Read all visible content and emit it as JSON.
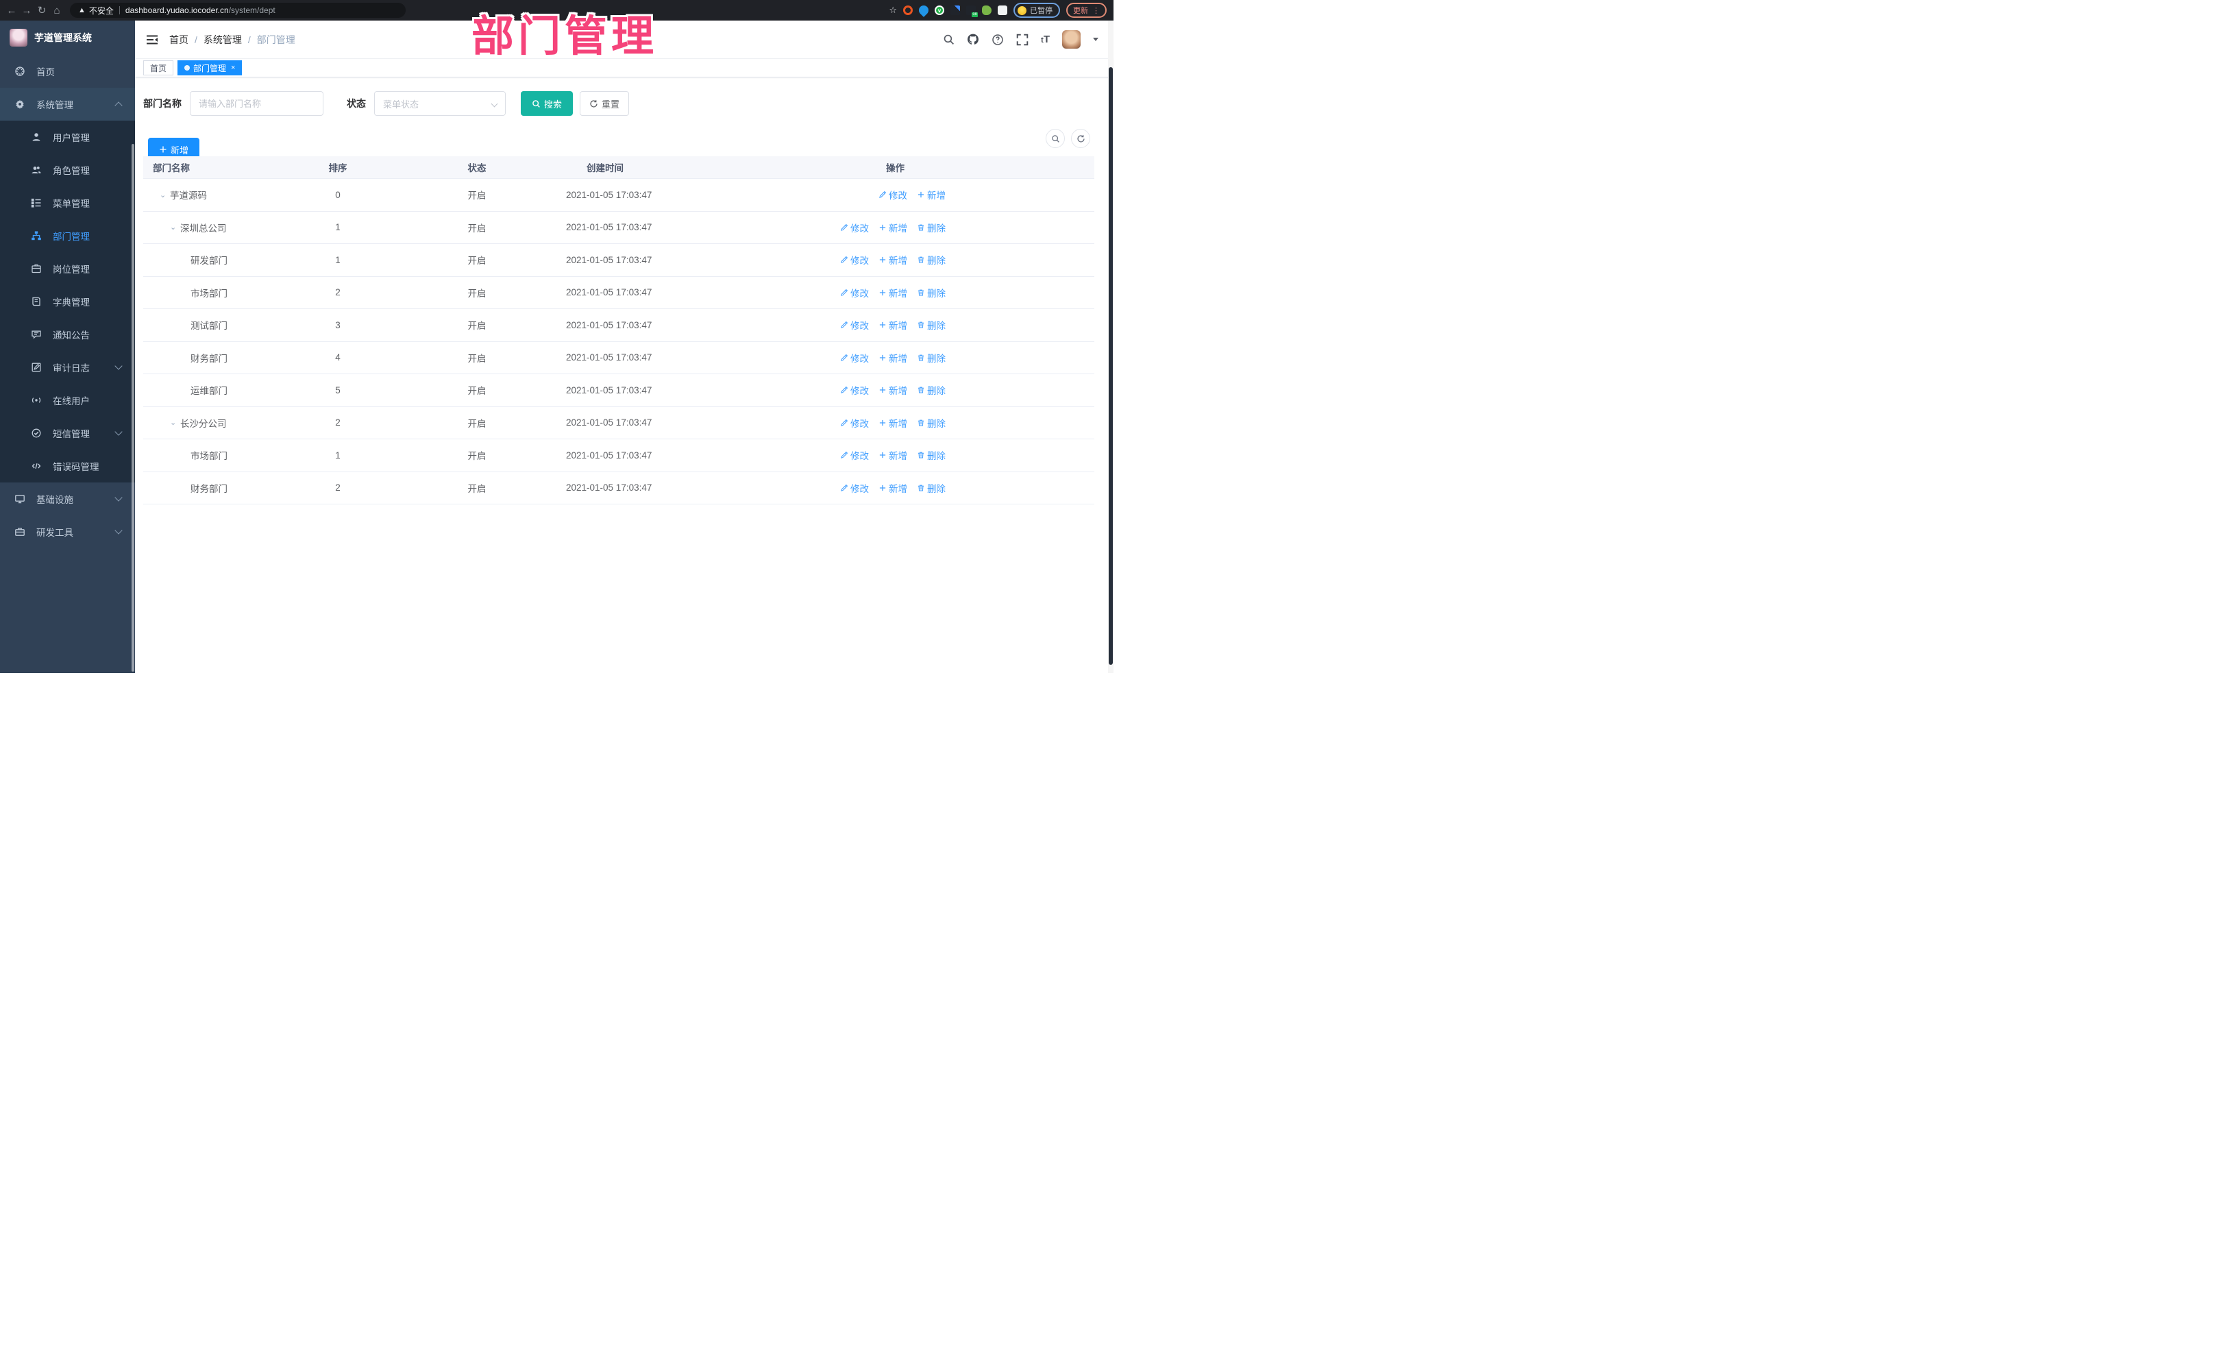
{
  "browser": {
    "security_label": "不安全",
    "url_host": "dashboard.yudao.iocoder.cn",
    "url_path": "/system/dept",
    "paused_label": "已暂停",
    "update_label": "更新"
  },
  "overlay": {
    "title": "部门管理"
  },
  "sidebar": {
    "app_title": "芋道管理系统",
    "items": [
      {
        "label": "首页",
        "icon": "dashboard-icon",
        "type": "top"
      },
      {
        "label": "系统管理",
        "icon": "gear-icon",
        "type": "top",
        "chevron": "up",
        "highlight": true
      },
      {
        "label": "用户管理",
        "icon": "user-icon",
        "type": "sub"
      },
      {
        "label": "角色管理",
        "icon": "users-icon",
        "type": "sub"
      },
      {
        "label": "菜单管理",
        "icon": "menu-tree-icon",
        "type": "sub"
      },
      {
        "label": "部门管理",
        "icon": "org-tree-icon",
        "type": "sub",
        "active": true
      },
      {
        "label": "岗位管理",
        "icon": "badge-icon",
        "type": "sub"
      },
      {
        "label": "字典管理",
        "icon": "book-icon",
        "type": "sub"
      },
      {
        "label": "通知公告",
        "icon": "announcement-icon",
        "type": "sub"
      },
      {
        "label": "审计日志",
        "icon": "audit-log-icon",
        "type": "sub",
        "chevron": "down"
      },
      {
        "label": "在线用户",
        "icon": "online-user-icon",
        "type": "sub"
      },
      {
        "label": "短信管理",
        "icon": "sms-icon",
        "type": "sub",
        "chevron": "down"
      },
      {
        "label": "错误码管理",
        "icon": "error-code-icon",
        "type": "sub"
      },
      {
        "label": "基础设施",
        "icon": "infra-icon",
        "type": "top",
        "chevron": "down"
      },
      {
        "label": "研发工具",
        "icon": "devtools-icon",
        "type": "top",
        "chevron": "down"
      }
    ]
  },
  "header": {
    "breadcrumb": [
      "首页",
      "系统管理",
      "部门管理"
    ]
  },
  "tags": [
    {
      "label": "首页",
      "active": false
    },
    {
      "label": "部门管理",
      "active": true
    }
  ],
  "filters": {
    "dept_name_label": "部门名称",
    "dept_name_placeholder": "请输入部门名称",
    "dept_name_value": "",
    "status_label": "状态",
    "status_placeholder": "菜单状态",
    "search_label": "搜索",
    "reset_label": "重置"
  },
  "toolbar": {
    "add_label": "新增"
  },
  "table": {
    "columns": [
      "部门名称",
      "排序",
      "状态",
      "创建时间",
      "操作"
    ],
    "action_labels": {
      "edit": "修改",
      "add": "新增",
      "delete": "删除"
    },
    "rows": [
      {
        "name": "芋道源码",
        "level": 0,
        "expandable": true,
        "sort": "0",
        "status": "开启",
        "created": "2021-01-05 17:03:47",
        "actions": [
          "edit",
          "add"
        ]
      },
      {
        "name": "深圳总公司",
        "level": 1,
        "expandable": true,
        "sort": "1",
        "status": "开启",
        "created": "2021-01-05 17:03:47",
        "actions": [
          "edit",
          "add",
          "delete"
        ]
      },
      {
        "name": "研发部门",
        "level": 2,
        "expandable": false,
        "sort": "1",
        "status": "开启",
        "created": "2021-01-05 17:03:47",
        "actions": [
          "edit",
          "add",
          "delete"
        ]
      },
      {
        "name": "市场部门",
        "level": 2,
        "expandable": false,
        "sort": "2",
        "status": "开启",
        "created": "2021-01-05 17:03:47",
        "actions": [
          "edit",
          "add",
          "delete"
        ]
      },
      {
        "name": "测试部门",
        "level": 2,
        "expandable": false,
        "sort": "3",
        "status": "开启",
        "created": "2021-01-05 17:03:47",
        "actions": [
          "edit",
          "add",
          "delete"
        ]
      },
      {
        "name": "财务部门",
        "level": 2,
        "expandable": false,
        "sort": "4",
        "status": "开启",
        "created": "2021-01-05 17:03:47",
        "actions": [
          "edit",
          "add",
          "delete"
        ]
      },
      {
        "name": "运维部门",
        "level": 2,
        "expandable": false,
        "sort": "5",
        "status": "开启",
        "created": "2021-01-05 17:03:47",
        "actions": [
          "edit",
          "add",
          "delete"
        ]
      },
      {
        "name": "长沙分公司",
        "level": 1,
        "expandable": true,
        "sort": "2",
        "status": "开启",
        "created": "2021-01-05 17:03:47",
        "actions": [
          "edit",
          "add",
          "delete"
        ]
      },
      {
        "name": "市场部门",
        "level": 2,
        "expandable": false,
        "sort": "1",
        "status": "开启",
        "created": "2021-01-05 17:03:47",
        "actions": [
          "edit",
          "add",
          "delete"
        ]
      },
      {
        "name": "财务部门",
        "level": 2,
        "expandable": false,
        "sort": "2",
        "status": "开启",
        "created": "2021-01-05 17:03:47",
        "actions": [
          "edit",
          "add",
          "delete"
        ]
      }
    ]
  },
  "colors": {
    "accent_blue": "#1890ff",
    "link_blue": "#409eff",
    "search_teal": "#16b5a2",
    "overlay_pink": "#f5437a",
    "sidebar_bg": "#304156",
    "submenu_bg": "#1f2d3d"
  }
}
